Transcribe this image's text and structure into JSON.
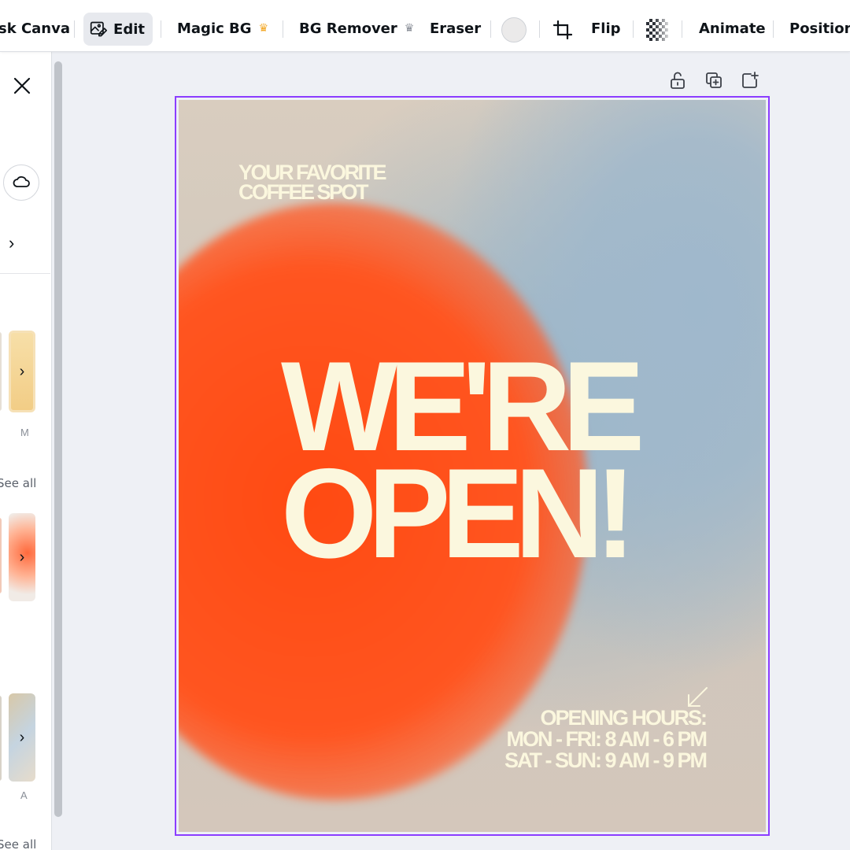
{
  "toolbar": {
    "ask_canva_label": "sk Canva",
    "edit_label": "Edit",
    "magic_bg_label": "Magic BG",
    "bg_remover_label": "BG Remover",
    "eraser_label": "Eraser",
    "flip_label": "Flip",
    "animate_label": "Animate",
    "position_label": "Position",
    "color_swatch": "#ebeaea",
    "crown_gold": "#f3a827",
    "crown_grey": "#8a8f98",
    "crown_glyph": "♛"
  },
  "side_panel": {
    "thumb1_caption": "M",
    "see_all_1": "See all",
    "thumb3_caption": "A",
    "see_all_2": "See all",
    "chevron_glyph": "›"
  },
  "selection_color": "#8b3dff",
  "poster": {
    "tagline": [
      "YOUR FAVORITE",
      "COFFEE SPOT"
    ],
    "headline": [
      "WE'RE",
      "OPEN!"
    ],
    "hours_title": "OPENING HOURS:",
    "hours_weekday": "MON - FRI: 8 AM - 6 PM",
    "hours_weekend": "SAT - SUN: 9 AM - 9 PM",
    "text_color": "#fbf7de",
    "orange": "#ff4a12",
    "blue": "#9fb8cc",
    "beige": "#d9cdbf"
  }
}
